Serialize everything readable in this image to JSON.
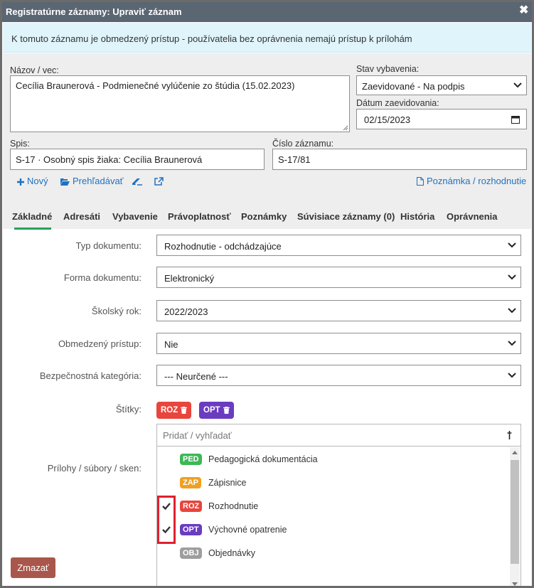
{
  "dialog": {
    "title": "Registratúrne záznamy: Upraviť záznam",
    "close_glyph": "✖"
  },
  "alert": {
    "text": "K tomuto záznamu je obmedzený prístup - používatelia bez oprávnenia nemajú prístup k prílohám"
  },
  "header": {
    "nazov_label": "Názov / vec:",
    "nazov_value": "Cecília Braunerová - Podmienečné vylúčenie zo štúdia (15.02.2023)",
    "stav_label": "Stav vybavenia:",
    "stav_value": "Zaevidované - Na podpis",
    "datum_label": "Dátum zaevidovania:",
    "datum_value": "02/15/2023",
    "spis_label": "Spis:",
    "spis_value": "S-17 · Osobný spis žiaka: Cecília Braunerová",
    "cislo_label": "Číslo záznamu:",
    "cislo_value": "S-17/81"
  },
  "toolbar": {
    "new_label": "Nový",
    "browse_label": "Prehľadávať",
    "note_label": "Poznámka / rozhodnutie"
  },
  "tabs": [
    {
      "label": "Základné",
      "active": true
    },
    {
      "label": "Adresáti"
    },
    {
      "label": "Vybavenie"
    },
    {
      "label": "Právoplatnosť"
    },
    {
      "label": "Poznámky"
    },
    {
      "label": "Súvisiace záznamy (0)"
    },
    {
      "label": "História"
    },
    {
      "label": "Oprávnenia"
    }
  ],
  "form": {
    "typ_label": "Typ dokumentu:",
    "typ_value": "Rozhodnutie - odchádzajúce",
    "forma_label": "Forma dokumentu:",
    "forma_value": "Elektronický",
    "rok_label": "Školský rok:",
    "rok_value": "2022/2023",
    "pristup_label": "Obmedzený prístup:",
    "pristup_value": "Nie",
    "kategoria_label": "Bezpečnostná kategória:",
    "kategoria_value": "--- Neurčené ---",
    "stitky_label": "Štítky:",
    "prilohy_label": "Prílohy / súbory / sken:"
  },
  "tags_selected": [
    {
      "code": "ROZ",
      "color": "#e8453c"
    },
    {
      "code": "OPT",
      "color": "#6a3cc0"
    }
  ],
  "tag_dropdown": {
    "placeholder": "Pridať / vyhľadať",
    "items": [
      {
        "code": "PED",
        "label": "Pedagogická dokumentácia",
        "color": "#3db757",
        "checked": false
      },
      {
        "code": "ZAP",
        "label": "Zápisnice",
        "color": "#f0a020",
        "checked": false
      },
      {
        "code": "ROZ",
        "label": "Rozhodnutie",
        "color": "#e8453c",
        "checked": true
      },
      {
        "code": "OPT",
        "label": "Výchovné opatrenie",
        "color": "#6a3cc0",
        "checked": true
      },
      {
        "code": "OBJ",
        "label": "Objednávky",
        "color": "#9e9e9e",
        "checked": false
      }
    ]
  },
  "footer": {
    "delete_label": "Zmazať"
  },
  "colors": {
    "titlebar": "#5b6673",
    "alert_bg": "#e0f4fc",
    "link": "#1f72c1",
    "tab_active_underline": "#29a05a",
    "delete_button": "#a9574c",
    "highlight": "#e0202e"
  }
}
